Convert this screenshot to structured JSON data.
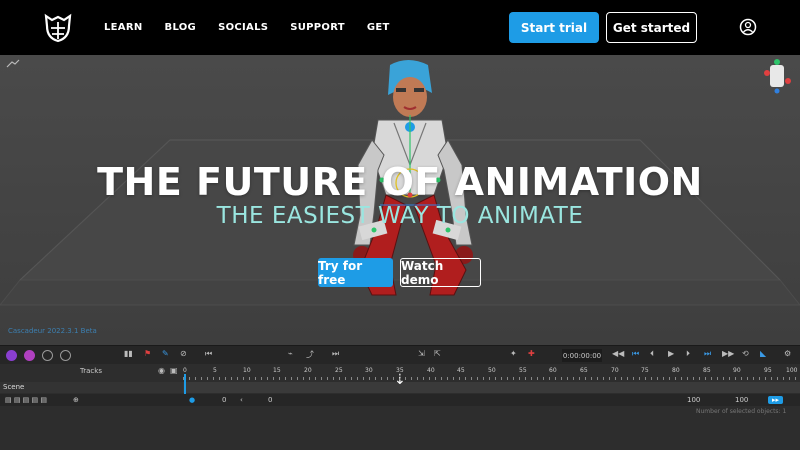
{
  "nav": {
    "links": [
      "LEARN",
      "BLOG",
      "SOCIALS",
      "SUPPORT",
      "GET"
    ],
    "start_trial": "Start trial",
    "get_started": "Get started"
  },
  "hero": {
    "title": "THE FUTURE OF ANIMATION",
    "subtitle": "THE EASIEST WAY TO ANIMATE",
    "try_free": "Try for free",
    "watch_demo": "Watch demo"
  },
  "viewport": {
    "version": "Cascadeur 2022.3.1 Beta"
  },
  "toolbar": {
    "time": "0:00:00:00"
  },
  "timeline": {
    "tracks_label": "Tracks",
    "scene_label": "Scene",
    "ruler": [
      "0",
      "5",
      "10",
      "15",
      "20",
      "25",
      "30",
      "35",
      "40",
      "45",
      "50",
      "55",
      "60",
      "65",
      "70",
      "75",
      "80",
      "85",
      "90",
      "95",
      "100"
    ],
    "start_frame": "0",
    "current_frame": "0",
    "end_frame_a": "100",
    "end_frame_b": "100",
    "selected_objects": "Number of selected objects: 1"
  },
  "colors": {
    "accent": "#1e9ce6",
    "subtitle": "#9ae6e0"
  }
}
